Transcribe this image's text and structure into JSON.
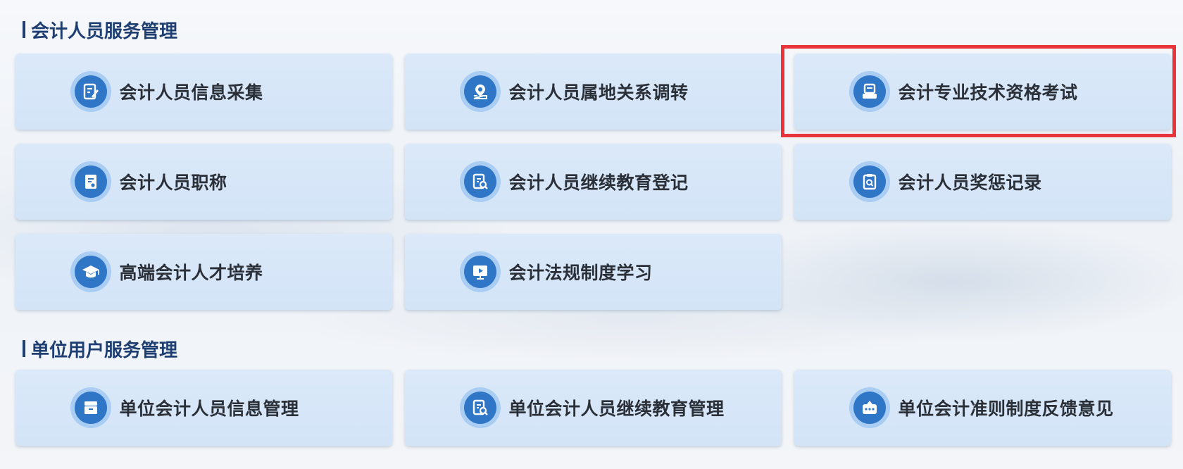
{
  "sections": [
    {
      "title": "会计人员服务管理",
      "items": [
        {
          "label": "会计人员信息采集",
          "icon": "edit-form-icon"
        },
        {
          "label": "会计人员属地关系调转",
          "icon": "location-pin-icon"
        },
        {
          "label": "会计专业技术资格考试",
          "icon": "exam-document-icon"
        },
        {
          "label": "会计人员职称",
          "icon": "certificate-star-icon"
        },
        {
          "label": "会计人员继续教育登记",
          "icon": "document-search-icon"
        },
        {
          "label": "会计人员奖惩记录",
          "icon": "clipboard-search-icon"
        },
        {
          "label": "高端会计人才培养",
          "icon": "graduation-cap-icon"
        },
        {
          "label": "会计法规制度学习",
          "icon": "video-play-icon"
        }
      ]
    },
    {
      "title": "单位用户服务管理",
      "items": [
        {
          "label": "单位会计人员信息管理",
          "icon": "archive-drawer-icon"
        },
        {
          "label": "单位会计人员继续教育管理",
          "icon": "document-search-icon"
        },
        {
          "label": "单位会计准则制度反馈意见",
          "icon": "feedback-chat-icon"
        }
      ]
    }
  ],
  "colors": {
    "title": "#1f3f73",
    "card_bg": "#d7e7f8",
    "icon_ring": "#a9cdf3",
    "icon_core": "#2f76c7",
    "highlight_border": "#e8343a"
  }
}
